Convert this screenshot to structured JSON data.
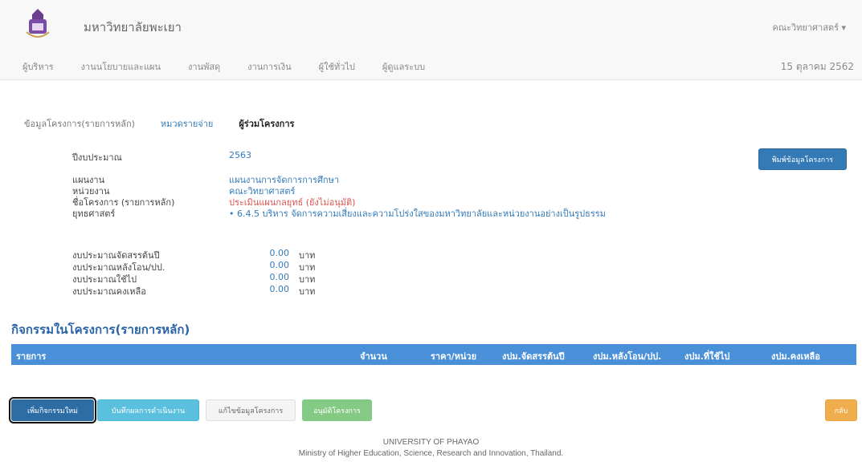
{
  "header": {
    "brand": "มหาวิทยาลัยพะเยา",
    "faculty_menu": "คณะวิทยาศาสตร์ ▾",
    "nav_items": [
      "ผู้บริหาร",
      "งานนโยบายและแผน",
      "งานพัสดุ",
      "งานการเงิน",
      "ผู้ใช้ทั่วไป",
      "ผู้ดูแลระบบ"
    ],
    "date": "15 ตุลาคม 2562"
  },
  "tabs": {
    "info": "ข้อมูลโครงการ(รายการหลัก)",
    "budget": "หมวดรายจ่าย",
    "members": "ผู้ร่วมโครงการ"
  },
  "project": {
    "fiscal_year_label": "ปีงบประมาณ",
    "fiscal_year": "2563",
    "plan_label": "แผนงาน",
    "plan": "แผนงานการจัดการการศึกษา",
    "unit_label": "หน่วยงาน",
    "unit": "คณะวิทยาศาสตร์",
    "name_label": "ชื่อโครงการ (รายการหลัก)",
    "name": "ประเมินแผนกลยุทธ์ (ยังไม่อนุมัติ)",
    "strategy_label": "ยุทธศาสตร์",
    "strategy": "• 6.4.5 บริหาร จัดการความเสี่ยงและความโปร่งใสของมหาวิทยาลัยและหน่วยงานอย่างเป็นรูปธรรม"
  },
  "budget": {
    "unit": "บาท",
    "rows": [
      {
        "label": "งบประมาณจัดสรรต้นปี",
        "amount": "0.00"
      },
      {
        "label": "งบประมาณหลังโอน/ปป.",
        "amount": "0.00"
      },
      {
        "label": "งบประมาณใช้ไป",
        "amount": "0.00"
      },
      {
        "label": "งบประมาณคงเหลือ",
        "amount": "0.00"
      }
    ]
  },
  "print_label": "พิมพ์ข้อมูลโครงการ",
  "activities": {
    "title": "กิจกรรมในโครงการ(รายการหลัก)",
    "columns": [
      "รายการ",
      "จำนวน",
      "ราคา/หน่วย",
      "งปม.จัดสรรต้นปี",
      "งปม.หลังโอน/ปป.",
      "งปม.ที่ใช้ไป",
      "งปม.คงเหลือ"
    ]
  },
  "buttons": {
    "add": "เพิ่มกิจกรรมใหม่",
    "record": "บันทึกผลการดำเนินงาน",
    "edit": "แก้ไขข้อมูลโครงการ",
    "approve": "อนุมัติโครงการ",
    "back": "กลับ"
  },
  "footer": {
    "line1": "UNIVERSITY OF PHAYAO",
    "line2": "Ministry of Higher Education, Science, Research and Innovation, Thailand."
  }
}
